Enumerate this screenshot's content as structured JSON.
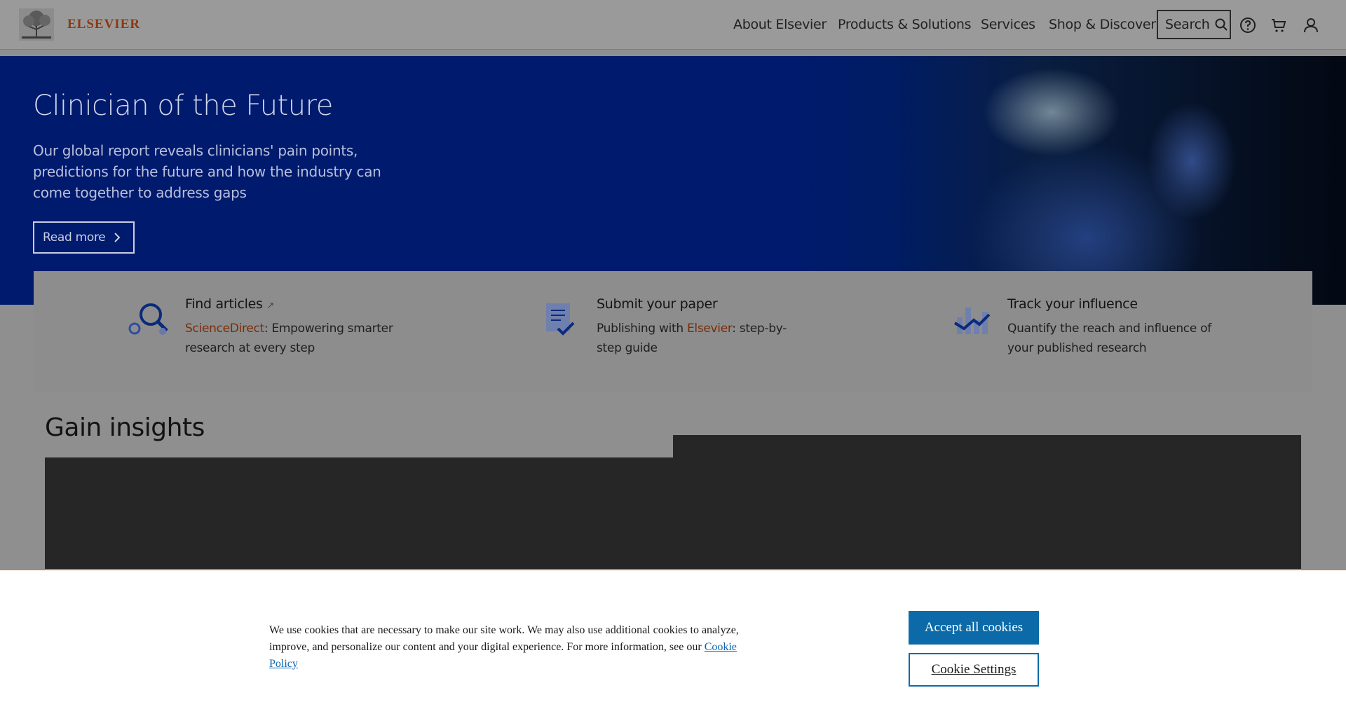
{
  "header": {
    "brand": "ELSEVIER",
    "nav": [
      "About Elsevier",
      "Products & Solutions",
      "Services",
      "Shop & Discover"
    ],
    "search_label": "Search",
    "icons": [
      "help-icon",
      "cart-icon",
      "user-icon"
    ]
  },
  "hero": {
    "title": "Clinician of the Future",
    "text": "Our global report reveals clinicians' pain points, predictions for the future and how the industry can come together to address gaps",
    "cta": "Read more"
  },
  "quicklinks": [
    {
      "title": "Find articles",
      "link": "ScienceDirect",
      "desc_rest": ": Empowering smarter research at every step",
      "icon": "search-articles-icon"
    },
    {
      "title": "Submit your paper",
      "desc_pre": "Publishing with ",
      "link": "Elsevier",
      "desc_rest": ": step-by-step guide",
      "icon": "document-check-icon"
    },
    {
      "title": "Track your influence",
      "desc": "Quantify the reach and influence of your published research",
      "icon": "chart-trend-icon"
    }
  ],
  "insights": {
    "title": "Gain insights"
  },
  "cookie": {
    "text": "We use cookies that are necessary to make our site work. We may also use additional cookies to analyze, improve, and personalize our content and your digital experience. For more information, see our ",
    "link": "Cookie Policy",
    "accept": "Accept all cookies",
    "settings": "Cookie Settings"
  },
  "colors": {
    "hero_bg": "#001a6e",
    "brand_orange": "#e8771e",
    "accept_button": "#0c6aa8"
  }
}
